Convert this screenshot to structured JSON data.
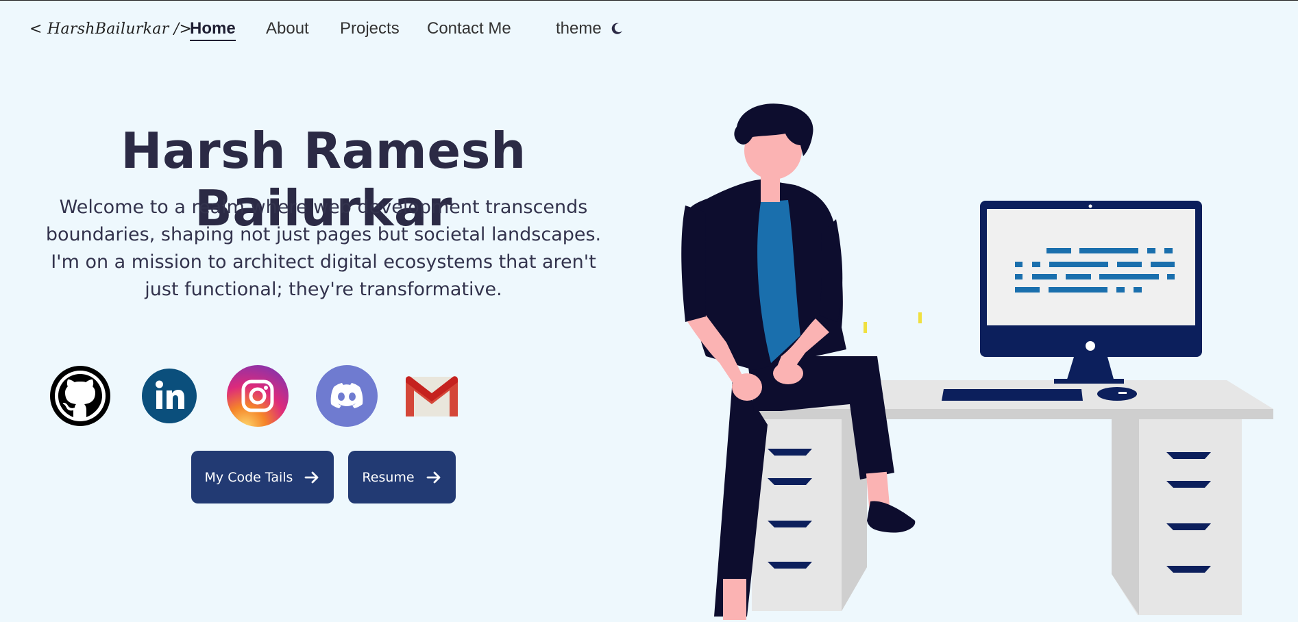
{
  "nav": {
    "logo": "< HarshBailurkar />",
    "links": [
      {
        "label": "Home",
        "active": true
      },
      {
        "label": "About",
        "active": false
      },
      {
        "label": "Projects",
        "active": false
      },
      {
        "label": "Contact Me",
        "active": false
      }
    ],
    "theme_label": "theme",
    "theme_icon": "moon-icon"
  },
  "hero": {
    "title": "Harsh Ramesh Bailurkar",
    "subtitle": "Welcome to a realm where web development transcends boundaries, shaping not just pages but societal landscapes. I'm on a mission to architect digital ecosystems that aren't just functional; they're transformative."
  },
  "social": [
    {
      "name": "github-icon",
      "color": "#000000"
    },
    {
      "name": "linkedin-icon",
      "color": "#0b4f7c"
    },
    {
      "name": "instagram-icon",
      "color": "#d62976"
    },
    {
      "name": "discord-icon",
      "color": "#6f7bd0"
    },
    {
      "name": "gmail-icon",
      "color": "#d44638"
    }
  ],
  "buttons": {
    "code_label": "My Code Tails",
    "resume_label": "Resume",
    "arrow_icon": "arrow-right-icon"
  },
  "colors": {
    "background": "#eef8fd",
    "button": "#223a73",
    "text": "#2b2a45",
    "accent_blue": "#1a6fad"
  }
}
